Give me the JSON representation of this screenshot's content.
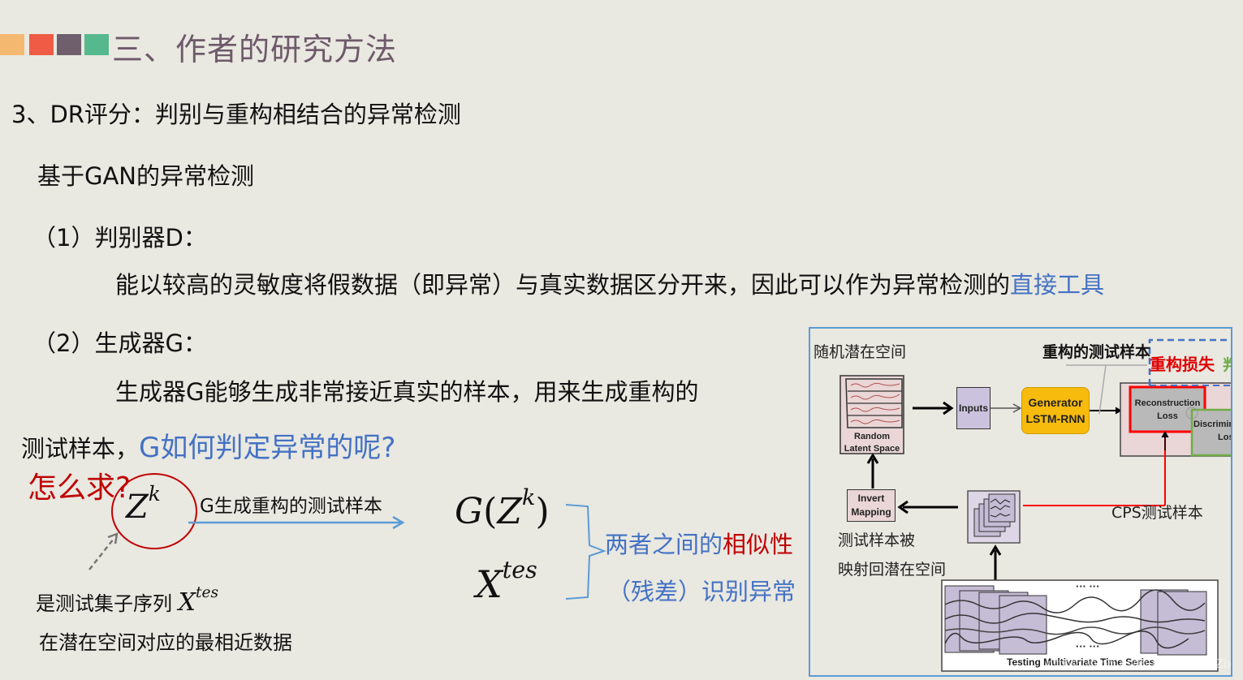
{
  "header": {
    "title": "三、作者的研究方法",
    "square_colors": [
      "#f4b870",
      "#ef5b44",
      "#6f5f6d",
      "#56b98e"
    ]
  },
  "content": {
    "section_heading": "3、DR评分：判别与重构相结合的异常检测",
    "subheading": "基于GAN的异常检测",
    "item1": {
      "label": "（1）判别器D：",
      "text": "能以较高的灵敏度将假数据（即异常）与真实数据区分开来，因此可以作为异常检测的",
      "highlight": "直接工具"
    },
    "item2": {
      "label": "（2）生成器G：",
      "text_line1": "生成器G能够生成非常接近真实的样本，用来生成重构的",
      "text_line2": "测试样本，",
      "question": "G如何判定异常的呢?"
    }
  },
  "annotations": {
    "how_question": "怎么求?",
    "zk_symbol": "Z",
    "zk_sup": "k",
    "arrow_label": "G生成重构的测试样本",
    "zk_desc_line1": "是测试集子序列",
    "xtes_symbol": "X",
    "xtes_sup": "tes",
    "zk_desc_line2": "在潜在空间对应的最相近数据",
    "gz_G": "G",
    "gz_open": "(",
    "gz_Z": "Z",
    "gz_sup": "k",
    "gz_close": ")",
    "similarity_prefix": "两者之间的",
    "similarity_highlight": "相似性",
    "residual_text": "（残差）识别异常"
  },
  "colors": {
    "accent_blue": "#4472c4",
    "accent_red": "#c00000",
    "title_color": "#6e5a6a",
    "background": "#e9e8e1"
  },
  "diagram": {
    "label_random_latent_cn": "随机潜在空间",
    "label_reconstructed_cn": "重构的测试样本",
    "label_recon_loss_cn": "重构损失",
    "label_discrim_loss_cn_partial": "判",
    "random_latent_space": [
      "Random",
      "Latent Space"
    ],
    "inputs": "Inputs",
    "generator": [
      "Generator",
      "LSTM-RNN"
    ],
    "reconstruction_loss": [
      "Reconstruction",
      "Loss"
    ],
    "discrimination_loss": [
      "Discrimin",
      "Loss"
    ],
    "invert_mapping": [
      "Invert",
      "Mapping"
    ],
    "mapping_desc_cn": [
      "测试样本被",
      "映射回潜在空间"
    ],
    "cps_label": "CPS测试样本",
    "ellipsis": "··· ···",
    "time_series_caption": "Testing Multivariate Time Series",
    "watermark": "https://blog.csdn.net/ZhangZixuan1111"
  }
}
